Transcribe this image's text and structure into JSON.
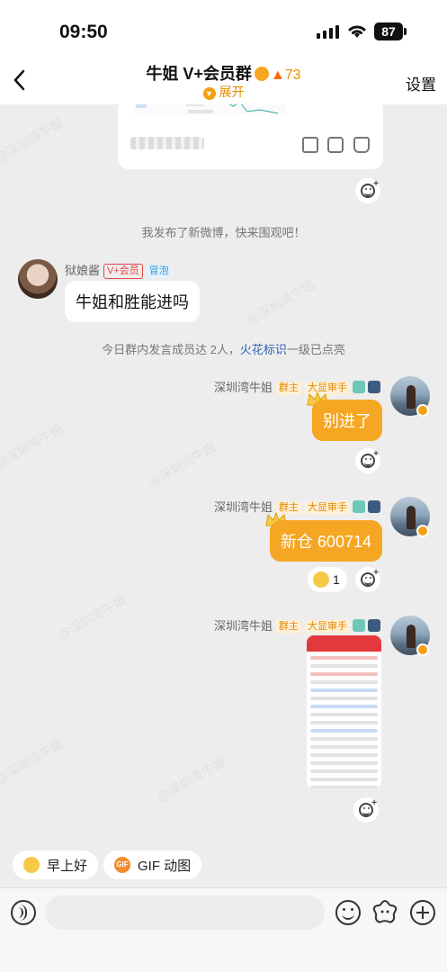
{
  "status": {
    "time": "09:50",
    "battery": "87"
  },
  "header": {
    "title": "牛姐 V+会员群",
    "member_count": "73",
    "expand_label": "展开",
    "settings_label": "设置"
  },
  "messages": {
    "system_1": "我发布了新微博，快来围观吧！",
    "user_1": {
      "name": "狱娘酱",
      "vip_tag": "V+会员",
      "bubble_tag": "冒泡",
      "text": "牛姐和胜能进吗"
    },
    "system_2": {
      "prefix": "今日群内发言成员达 2人，",
      "link": "火花标识",
      "suffix": "一级已点亮"
    },
    "owner_name": "深圳湾牛姐",
    "owner_tag": "群主",
    "fan_tag": "大显审手",
    "owner_1_text": "别进了",
    "owner_2_text": "新仓 600714",
    "reaction_count": "1"
  },
  "quick_chips": [
    "早上好",
    "GIF 动图"
  ],
  "input": {
    "placeholder": ""
  },
  "colors": {
    "accent": "#f5a623",
    "link": "#2a62b8",
    "background": "#ededed"
  }
}
